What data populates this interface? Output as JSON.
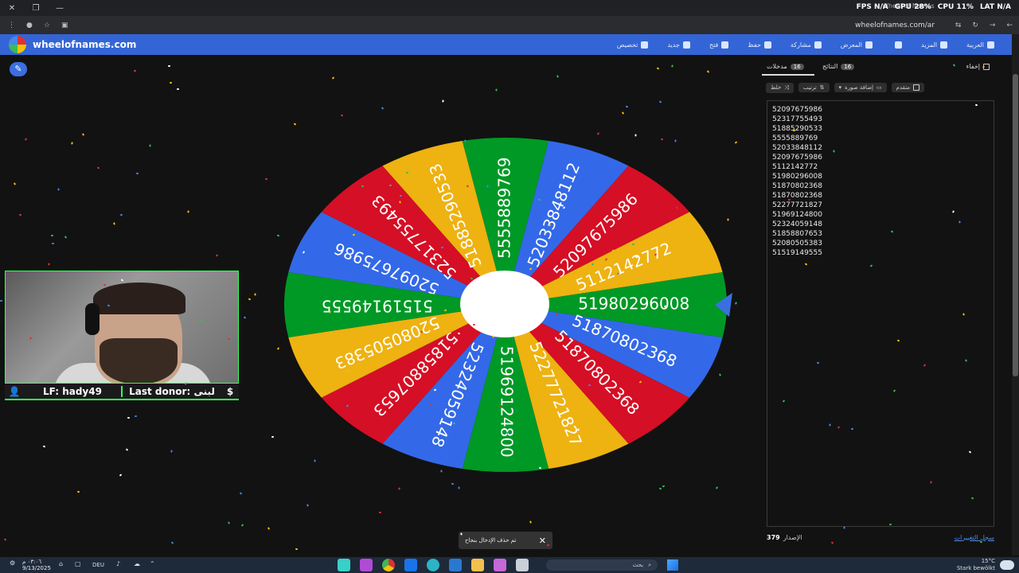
{
  "browser": {
    "tab_title": "Wheel of Names",
    "url": "wheelofnames.com/ar",
    "overlay": {
      "fps": "FPS N/A",
      "gpu": "GPU 28%",
      "cpu": "CPU 11%",
      "lat": "LAT N/A"
    }
  },
  "app": {
    "name": "wheelofnames.com",
    "menu": [
      {
        "label": "تخصيص",
        "icon": "palette-icon"
      },
      {
        "label": "جديد",
        "icon": "new-file-icon"
      },
      {
        "label": "فتح",
        "icon": "folder-icon"
      },
      {
        "label": "حفظ",
        "icon": "save-icon"
      },
      {
        "label": "مشاركة",
        "icon": "share-icon"
      },
      {
        "label": "المعرض",
        "icon": "search-icon"
      },
      {
        "label": "",
        "icon": "fullscreen-icon"
      },
      {
        "label": "المزيد",
        "icon": "chevron-down-icon"
      },
      {
        "label": "العربية",
        "icon": "globe-icon"
      }
    ]
  },
  "wheel": {
    "entries": [
      "52097675986",
      "52317755493",
      "51885290533",
      "5555889769",
      "52033848112",
      "52097675986",
      "5112142772",
      "51980296008",
      "51870802368",
      "51870802368",
      "52277721827",
      "51969124800",
      "52324059148",
      "51858807653",
      "52080505383",
      "51519149555"
    ],
    "colors": [
      "#3369e8",
      "#d50f25",
      "#eeb211",
      "#009925"
    ]
  },
  "webcam": {
    "lf": "LF: hady49",
    "last_donor": "Last donor: لبنى"
  },
  "panel": {
    "tab_entries": "مدخلات",
    "entries_count": "16",
    "tab_results": "النتائج",
    "results_count": "16",
    "hide_label": "إخفاء",
    "tools": {
      "shuffle": "خلط",
      "sort": "ترتيب",
      "add_image": "إضافة صورة",
      "advanced": "متقدم"
    },
    "list": [
      "52097675986",
      "52317755493",
      "51885290533",
      "5555889769",
      "52033848112",
      "52097675986",
      "5112142772",
      "51980296008",
      "51870802368",
      "51870802368",
      "52277721827",
      "51969124800",
      "52324059148",
      "51858807653",
      "52080505383",
      "51519149555"
    ],
    "version_number": "379",
    "version_label": "الإصدار",
    "changelog": "سجل التغييرات"
  },
  "toast": {
    "message": "تم حذف الإدخال بنجاح"
  },
  "taskbar": {
    "time": "٠٣:٠٦ م",
    "date": "9/13/2025",
    "lang": "DEU",
    "search": "بحث",
    "temp": "15°C",
    "weather": "Stark bewölkt"
  }
}
